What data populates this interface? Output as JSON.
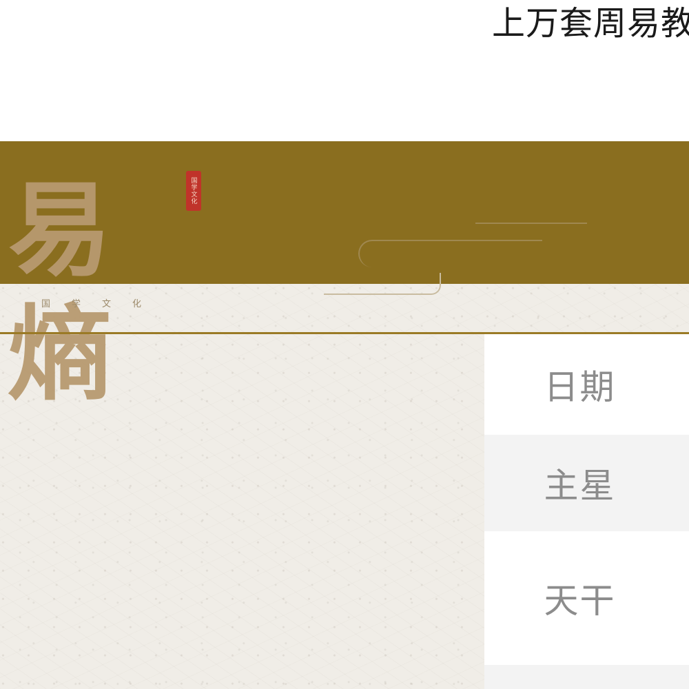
{
  "page": {
    "title": "上万套周易教"
  },
  "header": {
    "logo_text": "易熵",
    "seal_text": "国学文化",
    "subtitle": "国学文化",
    "colors": {
      "banner": "#8a6e1f",
      "accent_line": "#9a7a25",
      "seal": "#c0332a"
    }
  },
  "sidebar": {
    "items": [
      {
        "label": "日期"
      },
      {
        "label": "主星"
      },
      {
        "label": "天干"
      },
      {
        "label": ""
      }
    ]
  }
}
